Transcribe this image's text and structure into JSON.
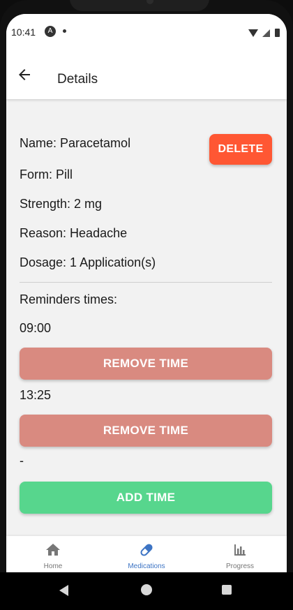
{
  "status_bar": {
    "time": "10:41",
    "app_icon_glyph": "A"
  },
  "app_bar": {
    "title": "Details",
    "back_icon": "arrow-back-icon"
  },
  "medication": {
    "name": "Name: Paracetamol",
    "form": "Form: Pill",
    "strength": "Strength: 2 mg",
    "reason": "Reason: Headache",
    "dosage": "Dosage: 1 Application(s)"
  },
  "delete_button": {
    "label": "DELETE",
    "color": "#ff5733"
  },
  "reminders": {
    "heading": "Reminders times:",
    "times": [
      "09:00",
      "13:25"
    ],
    "remove_label": "REMOVE TIME",
    "empty_marker": "-",
    "add_label": "ADD TIME",
    "remove_color": "#d98a80",
    "add_color": "#57d68d"
  },
  "bottom_nav": {
    "active_color": "#3d74c4",
    "inactive_color": "#777777",
    "items": [
      {
        "label": "Home",
        "icon": "home-icon",
        "active": false
      },
      {
        "label": "Medications",
        "icon": "pill-icon",
        "active": true
      },
      {
        "label": "Progress",
        "icon": "bar-chart-icon",
        "active": false
      }
    ]
  }
}
